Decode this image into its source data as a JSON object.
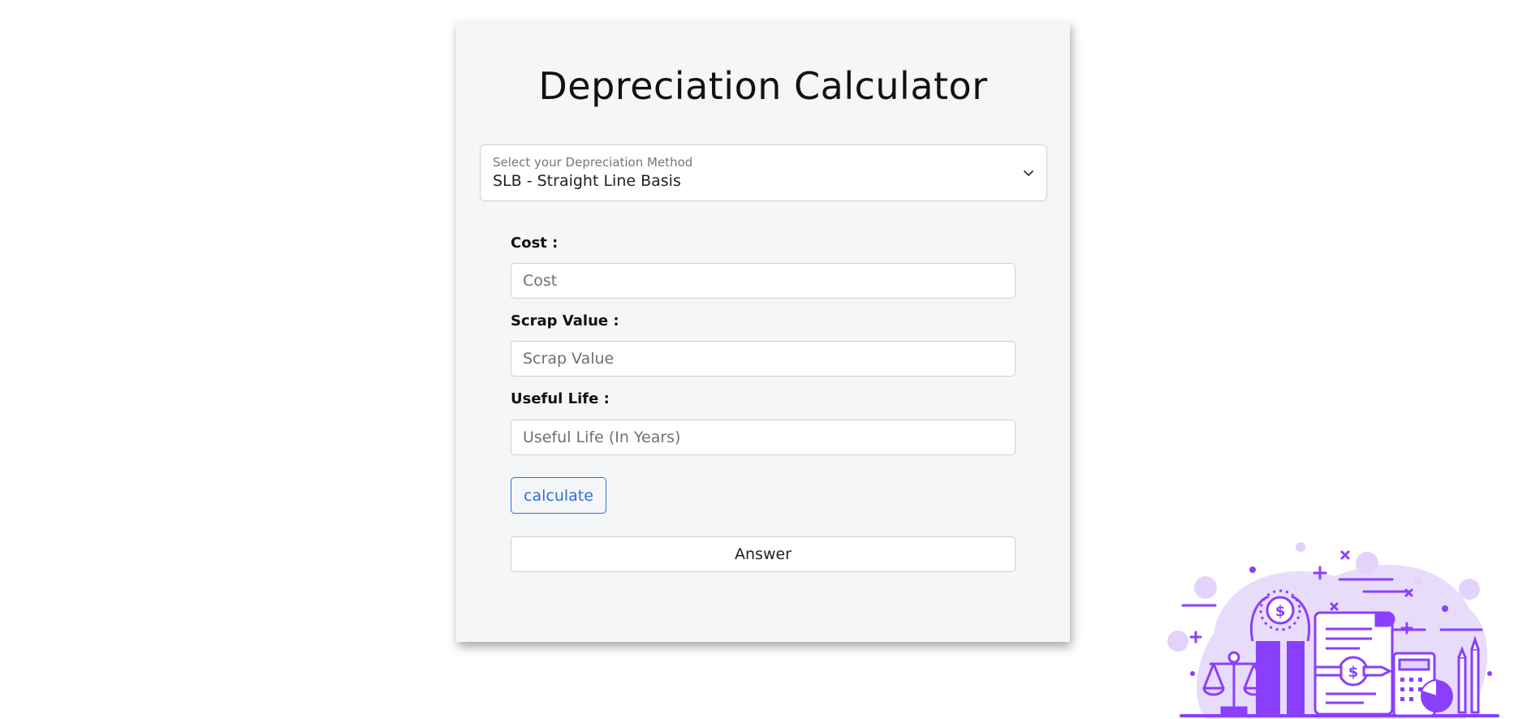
{
  "title": "Depreciation Calculator",
  "method_select": {
    "label": "Select your Depreciation Method",
    "selected": "SLB - Straight Line Basis"
  },
  "fields": {
    "cost": {
      "label": "Cost :",
      "placeholder": "Cost",
      "value": ""
    },
    "scrap": {
      "label": "Scrap Value :",
      "placeholder": "Scrap Value",
      "value": ""
    },
    "life": {
      "label": "Useful Life :",
      "placeholder": "Useful Life (In Years)",
      "value": ""
    }
  },
  "calculate_label": "calculate",
  "answer_text": "Answer",
  "colors": {
    "accent": "#2f6fdc",
    "illustration": "#8a3ffc",
    "illustration_light": "#e3d3fb",
    "card_bg": "#f5f6f8"
  },
  "illustration_icon": "finance-illustration"
}
